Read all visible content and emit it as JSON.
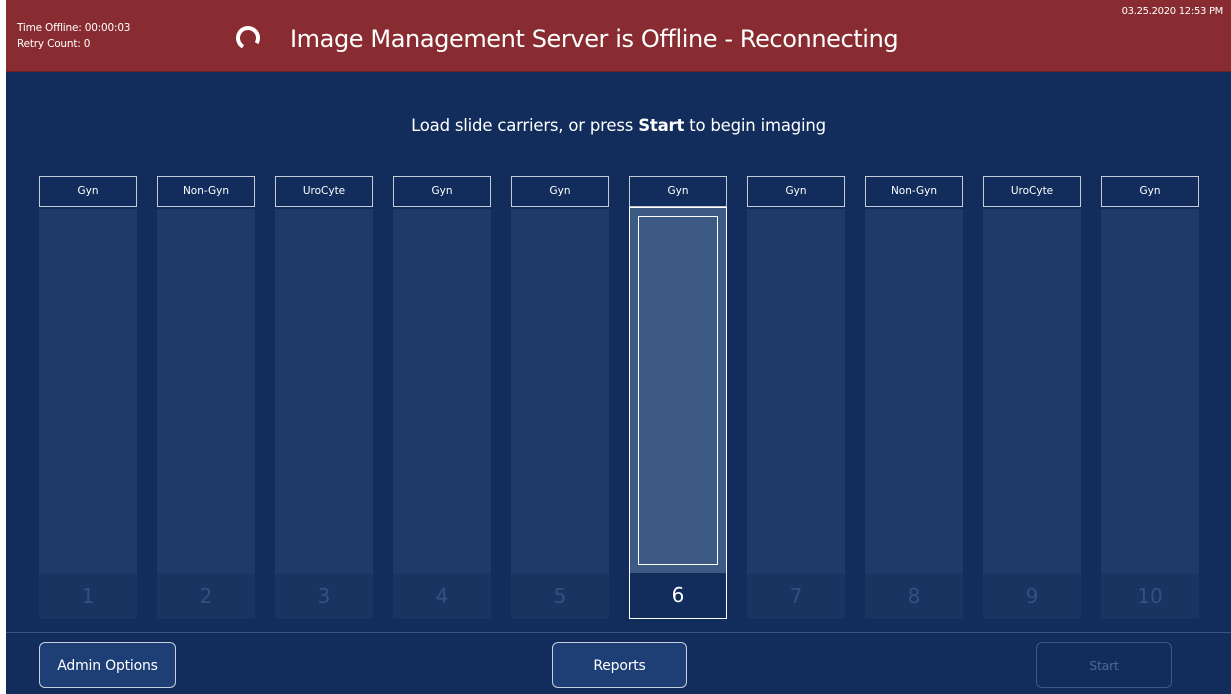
{
  "banner": {
    "time_offline_label": "Time Offline:",
    "time_offline_value": "00:00:03",
    "retry_count_label": "Retry Count:",
    "retry_count_value": "0",
    "title": "Image Management Server is Offline - Reconnecting",
    "datetime": "03.25.2020 12:53 PM",
    "spinner_icon": "loading-spinner-icon",
    "color": "#892c31"
  },
  "instruction": {
    "prefix": "Load slide carriers, or press ",
    "emphasis": "Start",
    "suffix": " to begin imaging"
  },
  "slots": [
    {
      "number": "1",
      "type": "Gyn"
    },
    {
      "number": "2",
      "type": "Non-Gyn"
    },
    {
      "number": "3",
      "type": "UroCyte"
    },
    {
      "number": "4",
      "type": "Gyn"
    },
    {
      "number": "5",
      "type": "Gyn"
    },
    {
      "number": "6",
      "type": "Gyn",
      "selected": true
    },
    {
      "number": "7",
      "type": "Gyn"
    },
    {
      "number": "8",
      "type": "Non-Gyn"
    },
    {
      "number": "9",
      "type": "UroCyte"
    },
    {
      "number": "10",
      "type": "Gyn"
    }
  ],
  "footer": {
    "admin_label": "Admin Options",
    "reports_label": "Reports",
    "start_label": "Start"
  }
}
